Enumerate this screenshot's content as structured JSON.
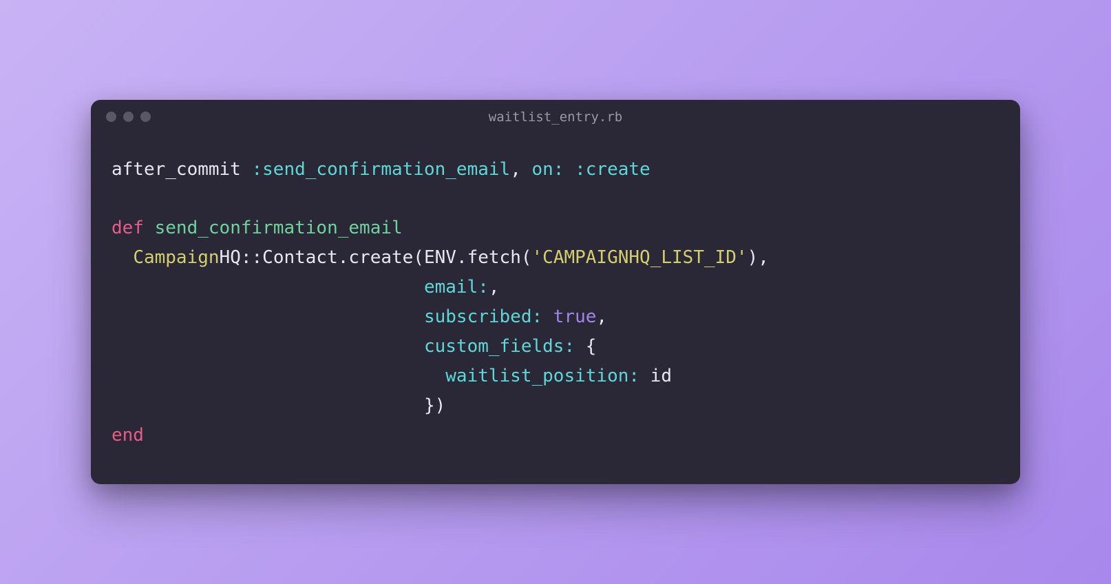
{
  "filename": "waitlist_entry.rb",
  "code": {
    "line1": {
      "after_commit": "after_commit",
      "symbol1": ":send_confirmation_email",
      "comma1": ",",
      "on_key": "on:",
      "on_val": ":create"
    },
    "line3": {
      "def": "def",
      "name": "send_confirmation_email"
    },
    "line4": {
      "indent": "  ",
      "campaign": "Campaign",
      "hq_contact": "HQ::Contact",
      "dot_create": ".create(",
      "env": "ENV",
      "dot_fetch": ".fetch(",
      "string": "'CAMPAIGNHQ_LIST_ID'",
      "close": "),"
    },
    "line5": {
      "indent": "                             ",
      "key": "email:",
      "comma": ","
    },
    "line6": {
      "indent": "                             ",
      "key": "subscribed:",
      "val": "true",
      "comma": ","
    },
    "line7": {
      "indent": "                             ",
      "key": "custom_fields:",
      "brace": " {"
    },
    "line8": {
      "indent": "                               ",
      "key": "waitlist_position:",
      "val": " id"
    },
    "line9": {
      "indent": "                             ",
      "close": "})"
    },
    "line10": {
      "end": "end"
    }
  }
}
